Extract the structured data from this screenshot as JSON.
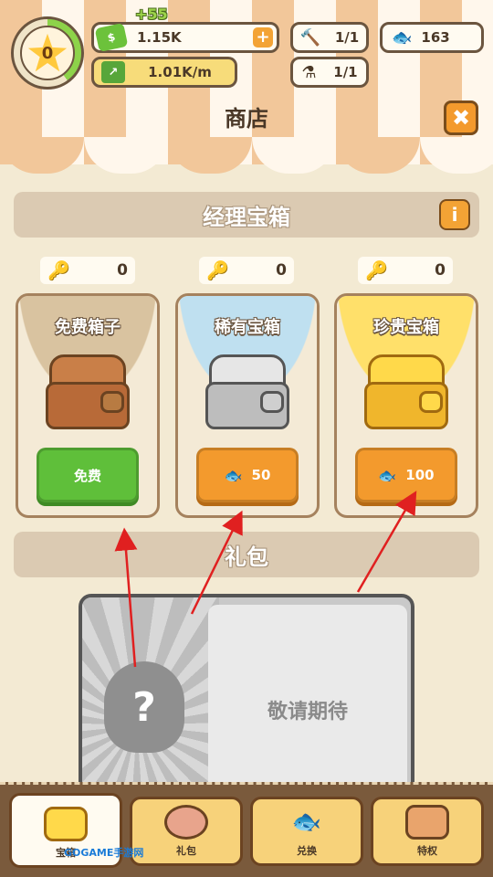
{
  "hud": {
    "level": "0",
    "money_gain": "+55",
    "money": "1.15K",
    "income_rate": "1.01K/m",
    "hammer_count": "1/1",
    "potion_count": "1/1",
    "fish_count": "163"
  },
  "header": {
    "title": "商店",
    "close_label": "✖"
  },
  "manager_chest": {
    "title": "经理宝箱",
    "info_label": "i",
    "keys": [
      {
        "color": "#d98a4a",
        "count": "0"
      },
      {
        "color": "#9a9a9a",
        "count": "0"
      },
      {
        "color": "#f0b62c",
        "count": "0"
      }
    ],
    "cards": [
      {
        "name": "免费箱子",
        "button_label": "免费",
        "price": ""
      },
      {
        "name": "稀有宝箱",
        "button_label": "",
        "price": "50"
      },
      {
        "name": "珍贵宝箱",
        "button_label": "",
        "price": "100"
      }
    ]
  },
  "gift": {
    "title": "礼包",
    "mystery_label": "?",
    "coming_soon": "敬请期待"
  },
  "bottom_nav": {
    "tabs": [
      {
        "label": "宝箱",
        "icon": "chest-icon",
        "active": true
      },
      {
        "label": "礼包",
        "icon": "piggy-icon",
        "active": false
      },
      {
        "label": "兑换",
        "icon": "fish-icon",
        "active": false
      },
      {
        "label": "特权",
        "icon": "cat-box-icon",
        "active": false
      }
    ]
  },
  "watermark": "GOGAME手游网",
  "colors": {
    "accent_orange": "#f39a2d",
    "accent_green": "#5fbf3a",
    "annotation_red": "#e02020"
  }
}
